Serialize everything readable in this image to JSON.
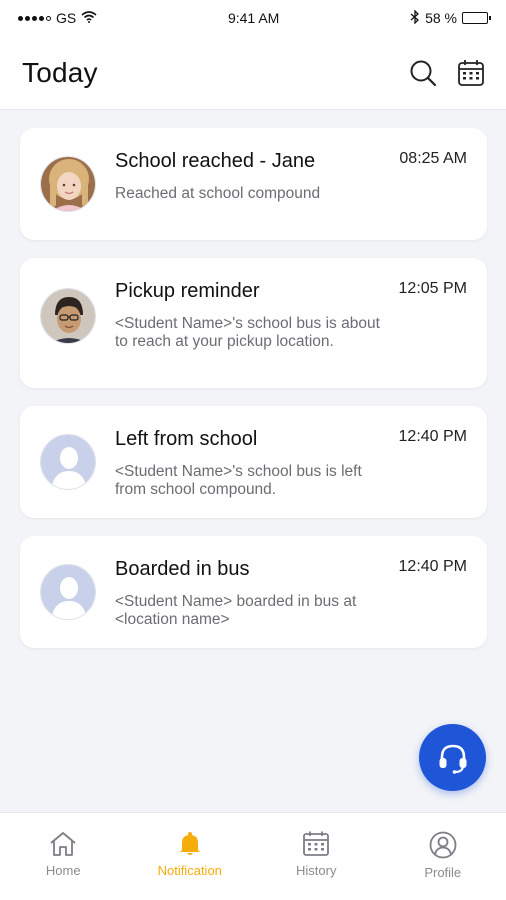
{
  "status_bar": {
    "carrier": "GS",
    "time": "9:41 AM",
    "battery": "58 %",
    "battery_level": 0.58
  },
  "header": {
    "title": "Today"
  },
  "notifications": [
    {
      "title": "School reached - Jane",
      "time": "08:25 AM",
      "body": "Reached at school compound",
      "avatar": "girl-photo"
    },
    {
      "title": "Pickup reminder",
      "time": "12:05 PM",
      "body": "<Student Name>'s school bus is about to reach at your pickup location.",
      "avatar": "boy-photo"
    },
    {
      "title": "Left from school",
      "time": "12:40 PM",
      "body": "<Student Name>'s school bus is left from school compound.",
      "avatar": "placeholder"
    },
    {
      "title": "Boarded in bus",
      "time": "12:40 PM",
      "body": "<Student Name> boarded in bus at <location name>",
      "avatar": "placeholder"
    }
  ],
  "tabs": [
    {
      "label": "Home",
      "icon": "home-icon"
    },
    {
      "label": "Notification",
      "icon": "bell-icon",
      "active": true
    },
    {
      "label": "History",
      "icon": "calendar-icon"
    },
    {
      "label": "Profile",
      "icon": "user-circle-icon"
    }
  ],
  "colors": {
    "accent": "#f4ad0b",
    "fab": "#1f56d8",
    "background": "#f3f4f8"
  }
}
